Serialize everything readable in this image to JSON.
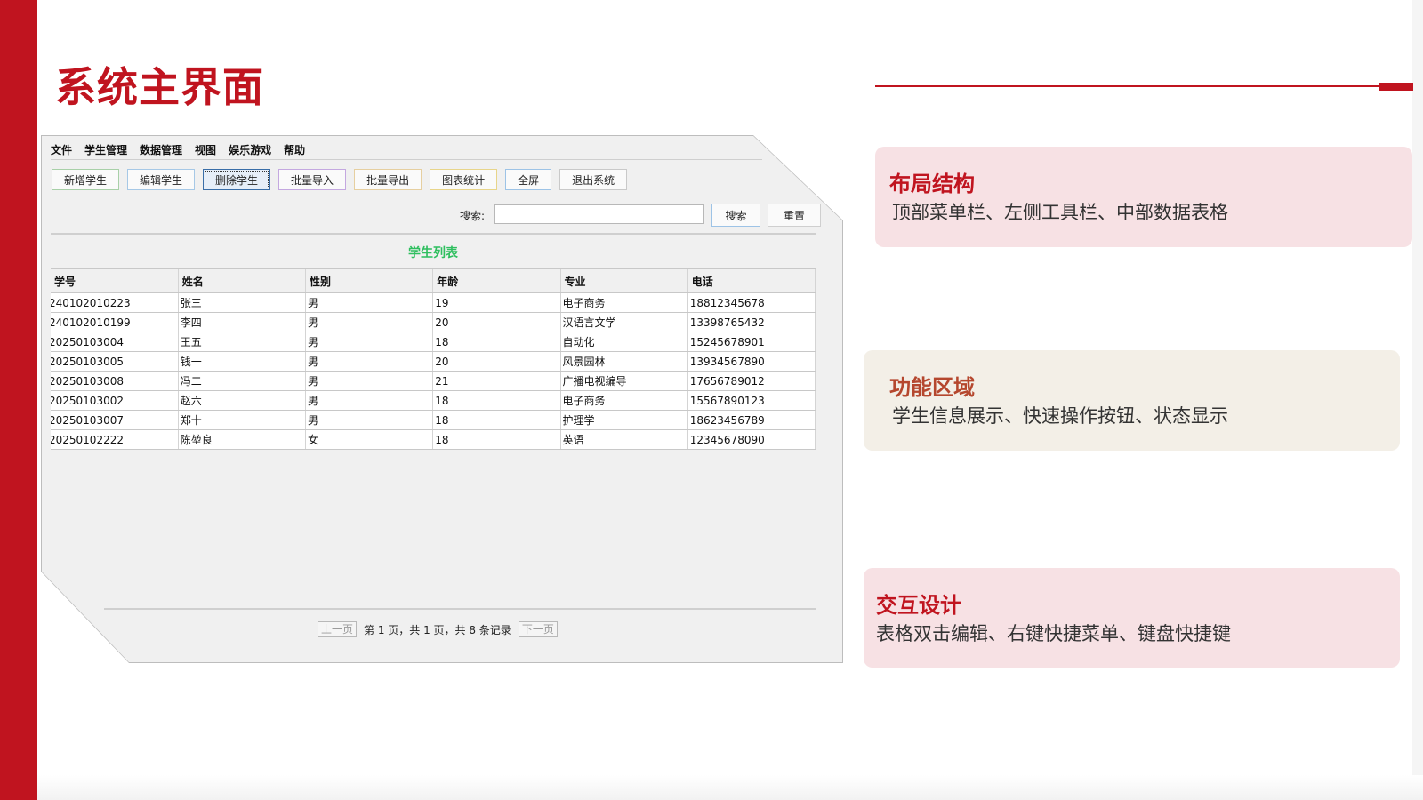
{
  "slide": {
    "title": "系统主界面",
    "accent_color": "#c0141f"
  },
  "app": {
    "menu": [
      "文件",
      "学生管理",
      "数据管理",
      "视图",
      "娱乐游戏",
      "帮助"
    ],
    "toolbar": [
      "新增学生",
      "编辑学生",
      "删除学生",
      "批量导入",
      "批量导出",
      "图表统计",
      "全屏",
      "退出系统"
    ],
    "search": {
      "label": "搜索:",
      "value": "",
      "button": "搜索",
      "reset": "重置"
    },
    "table": {
      "caption": "学生列表",
      "columns": [
        "学号",
        "姓名",
        "性别",
        "年龄",
        "专业",
        "电话"
      ],
      "rows": [
        [
          "240102010223",
          "张三",
          "男",
          "19",
          "电子商务",
          "18812345678"
        ],
        [
          "240102010199",
          "李四",
          "男",
          "20",
          "汉语言文学",
          "13398765432"
        ],
        [
          "20250103004",
          "王五",
          "男",
          "18",
          "自动化",
          "15245678901"
        ],
        [
          "20250103005",
          "钱一",
          "男",
          "20",
          "风景园林",
          "13934567890"
        ],
        [
          "20250103008",
          "冯二",
          "男",
          "21",
          "广播电视编导",
          "17656789012"
        ],
        [
          "20250103002",
          "赵六",
          "男",
          "18",
          "电子商务",
          "15567890123"
        ],
        [
          "20250103007",
          "郑十",
          "男",
          "18",
          "护理学",
          "18623456789"
        ],
        [
          "20250102222",
          "陈堃良",
          "女",
          "18",
          "英语",
          "12345678090"
        ]
      ]
    },
    "pager": {
      "prev": "上一页",
      "status": "第 1 页，共 1 页，共 8 条记录",
      "next": "下一页"
    }
  },
  "cards": [
    {
      "title": "布局结构",
      "desc": "顶部菜单栏、左侧工具栏、中部数据表格"
    },
    {
      "title": "功能区域",
      "desc": "学生信息展示、快速操作按钮、状态显示"
    },
    {
      "title": "交互设计",
      "desc": "表格双击编辑、右键快捷菜单、键盘快捷键"
    }
  ]
}
